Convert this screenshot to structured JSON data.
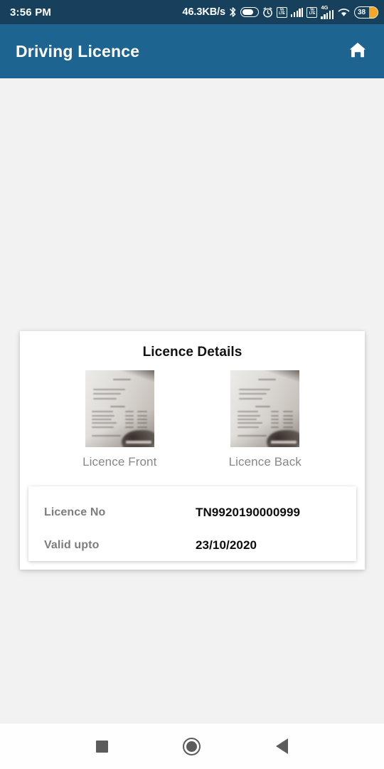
{
  "status_bar": {
    "time": "3:56 PM",
    "network_speed": "46.3KB/s",
    "volte_top": "Vo",
    "volte_bottom": "LTE",
    "network_type": "4G",
    "battery_level": "38",
    "icons": [
      "bluetooth-icon",
      "battery-saver-icon",
      "alarm-icon",
      "volte-icon",
      "signal-bars-icon",
      "volte-icon",
      "4g-icon",
      "signal-bars-icon",
      "wifi-icon",
      "battery-icon"
    ],
    "colors": {
      "background": "#16405c",
      "battery_fill": "#f5a623"
    }
  },
  "app_bar": {
    "title": "Driving Licence",
    "home_icon": "home-icon",
    "colors": {
      "background": "#1e6491",
      "text": "#ffffff"
    }
  },
  "card": {
    "title": "Licence Details",
    "thumbnails": [
      {
        "label": "Licence Front",
        "image": "licence-front-photo"
      },
      {
        "label": "Licence Back",
        "image": "licence-back-photo"
      }
    ],
    "details": [
      {
        "label": "Licence No",
        "value": "TN9920190000999"
      },
      {
        "label": "Valid upto",
        "value": "23/10/2020"
      }
    ]
  },
  "nav_bar": {
    "buttons": [
      "recents-button",
      "home-button",
      "back-button"
    ]
  },
  "page": {
    "background": "#f2f2f2"
  }
}
